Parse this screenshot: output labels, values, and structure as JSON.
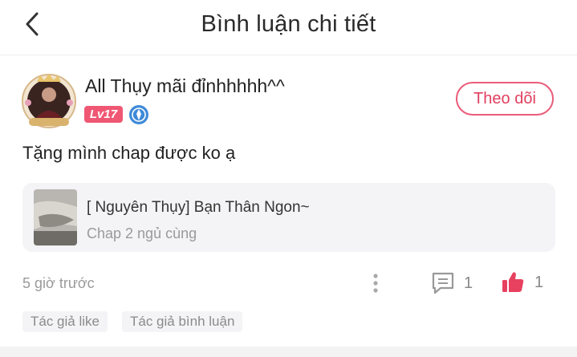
{
  "header": {
    "back_icon": "chevron-left-icon",
    "title": "Bình luận chi tiết"
  },
  "comment": {
    "username": "All Thụy mãi đỉnhhhhh^^",
    "level": "Lv17",
    "verify_icon": "verified-badge-icon",
    "follow_label": "Theo dõi",
    "text": "Tặng mình chap được ko ạ",
    "story": {
      "title": "[ Nguyên Thụy] Bạn Thân Ngon~",
      "chapter": "Chap 2 ngủ cùng"
    },
    "time": "5 giờ trước",
    "reply_count": "1",
    "like_count": "1",
    "tags": [
      "Tác giả like",
      "Tác giả bình luận"
    ]
  },
  "colors": {
    "accent": "#ea5c79",
    "level_badge": "#ef5773",
    "like": "#e8405f",
    "verify": "#3f8ad8",
    "card_bg": "#f4f4f6"
  }
}
